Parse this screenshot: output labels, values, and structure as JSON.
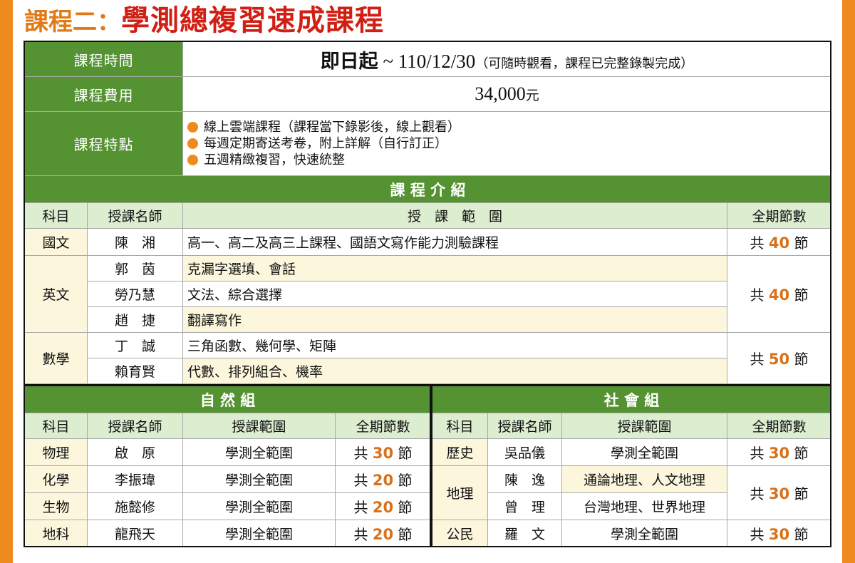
{
  "title": {
    "prefix": "課程二：",
    "main": "學測總複習速成課程"
  },
  "info": {
    "time_label": "課程時間",
    "time_start": "即日起",
    "time_sep": " ~ ",
    "time_end": "110/12/30",
    "time_note": "（可隨時觀看，課程已完整錄製完成）",
    "fee_label": "課程費用",
    "fee_value": "34,000",
    "fee_unit": "元",
    "features_label": "課程特點",
    "features": [
      "線上雲端課程（課程當下錄影後，線上觀看）",
      "每週定期寄送考卷，附上詳解（自行訂正）",
      "五週精緻複習，快速統整"
    ]
  },
  "intro": {
    "heading": "課 程 介 紹",
    "headers": [
      "科目",
      "授課名師",
      "授　課　範　圍",
      "全期節數"
    ],
    "count_prefix": "共",
    "count_suffix": "節",
    "groups": [
      {
        "subject": "國文",
        "count": "40",
        "rows": [
          {
            "teacher": "陳　湘",
            "range": "高一、高二及高三上課程、國語文寫作能力測驗課程"
          }
        ]
      },
      {
        "subject": "英文",
        "count": "40",
        "rows": [
          {
            "teacher": "郭　茵",
            "range": "克漏字選填、會話"
          },
          {
            "teacher": "勞乃慧",
            "range": "文法、綜合選擇"
          },
          {
            "teacher": "趙　捷",
            "range": "翻譯寫作"
          }
        ]
      },
      {
        "subject": "數學",
        "count": "50",
        "rows": [
          {
            "teacher": "丁　誠",
            "range": "三角函數、幾何學、矩陣"
          },
          {
            "teacher": "賴育賢",
            "range": "代數、排列組合、機率"
          }
        ]
      }
    ]
  },
  "science": {
    "heading": "自 然 組",
    "headers": [
      "科目",
      "授課名師",
      "授課範圍",
      "全期節數"
    ],
    "rows": [
      {
        "subject": "物理",
        "teacher": "啟　原",
        "range": "學測全範圍",
        "count": "30"
      },
      {
        "subject": "化學",
        "teacher": "李振瑋",
        "range": "學測全範圍",
        "count": "20"
      },
      {
        "subject": "生物",
        "teacher": "施懿修",
        "range": "學測全範圍",
        "count": "20"
      },
      {
        "subject": "地科",
        "teacher": "龍飛天",
        "range": "學測全範圍",
        "count": "20"
      }
    ]
  },
  "social": {
    "heading": "社 會 組",
    "headers": [
      "科目",
      "授課名師",
      "授課範圍",
      "全期節數"
    ],
    "rows": [
      {
        "subject": "歷史",
        "teacher": "吳品儀",
        "range": "學測全範圍",
        "count": "30"
      },
      {
        "subject": "地理",
        "teacher": "陳　逸",
        "range": "通論地理、人文地理",
        "count": "30"
      },
      {
        "subject": "",
        "teacher": "曾　理",
        "range": "台灣地理、世界地理",
        "count": ""
      },
      {
        "subject": "公民",
        "teacher": "羅　文",
        "range": "學測全範圍",
        "count": "30"
      }
    ]
  },
  "colors": {
    "green": "#549232",
    "orange": "#ef8a1f",
    "red": "#d11f14",
    "light_green": "#dcedd0",
    "cream": "#fbf6dc"
  }
}
